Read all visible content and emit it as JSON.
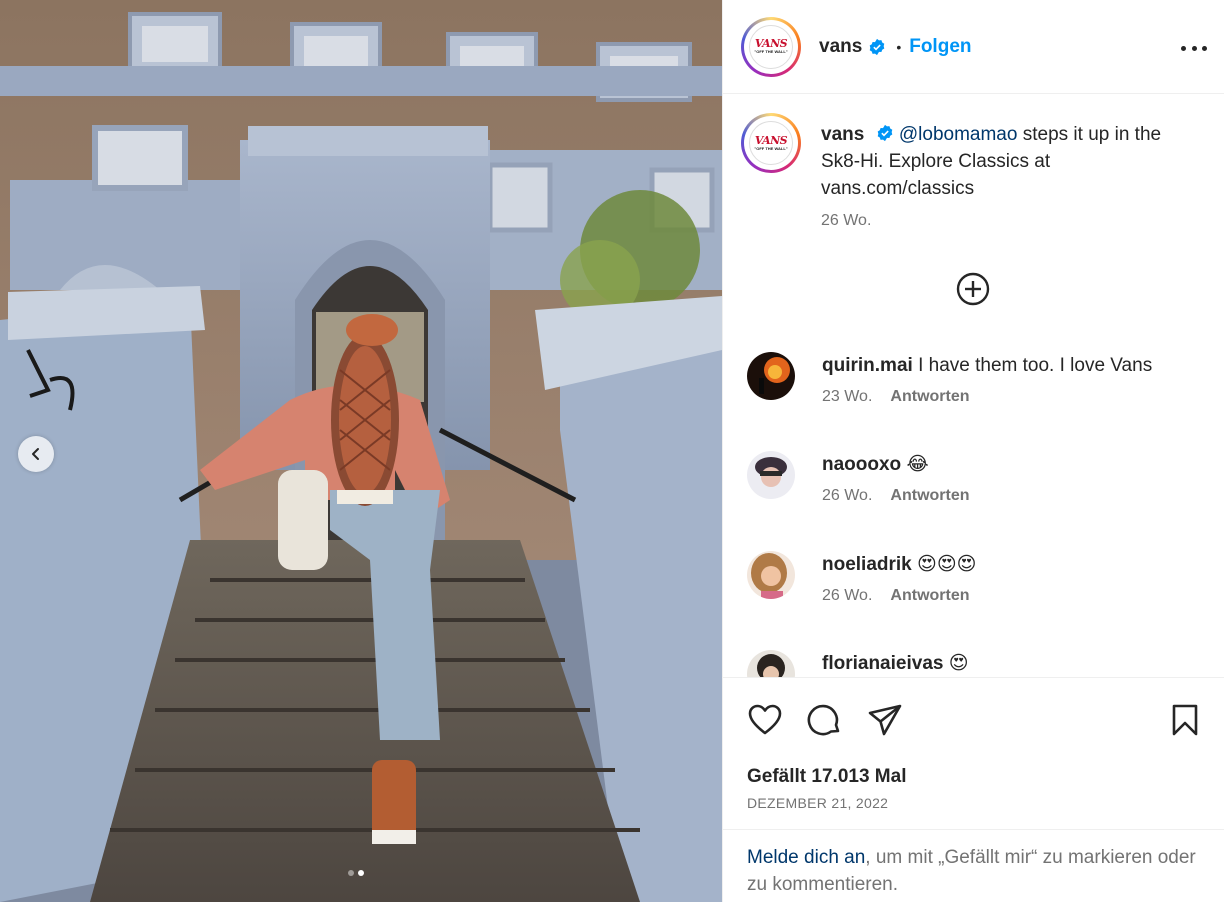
{
  "post": {
    "author": "vans",
    "verified": true,
    "separator": "•",
    "follow_label": "Folgen",
    "avatar_logo": {
      "line1": "VANS",
      "line2": "\"OFF THE WALL\""
    },
    "caption": {
      "username": "vans",
      "mention": "@lobomamao",
      "text": " steps it up in the Sk8-Hi. Explore Classics at vans.com/classics",
      "age": "26 Wo."
    },
    "likes_label": "Gefällt 17.013 Mal",
    "date": "DEZEMBER 21, 2022"
  },
  "comments": [
    {
      "username": "quirin.mai",
      "text": "I have them too. I love Vans",
      "age": "23 Wo.",
      "reply_label": "Antworten"
    },
    {
      "username": "naoooxo",
      "text": "😂",
      "age": "26 Wo.",
      "reply_label": "Antworten"
    },
    {
      "username": "noeliadrik",
      "text": "😍😍😍",
      "age": "26 Wo.",
      "reply_label": "Antworten"
    },
    {
      "username": "florianaieivas",
      "text": "😍",
      "age": "",
      "reply_label": ""
    }
  ],
  "login_prompt": {
    "link": "Melde dich an",
    "rest": ", um mit „Gefällt mir“ zu markieren oder zu kommentieren."
  },
  "media": {
    "total_slides": 2,
    "active_slide": 2
  },
  "icons": {
    "carousel_prev": "chevron-left-icon",
    "more": "more-horizontal-icon",
    "load_more": "circle-plus-icon",
    "like": "heart-icon",
    "comment": "comment-bubble-icon",
    "share": "paper-plane-icon",
    "save": "bookmark-icon",
    "verified": "verified-badge-icon"
  },
  "colors": {
    "accent": "#0095f6",
    "link": "#00376b",
    "muted": "#737373",
    "text": "#262626",
    "verified": "#0095f6"
  }
}
